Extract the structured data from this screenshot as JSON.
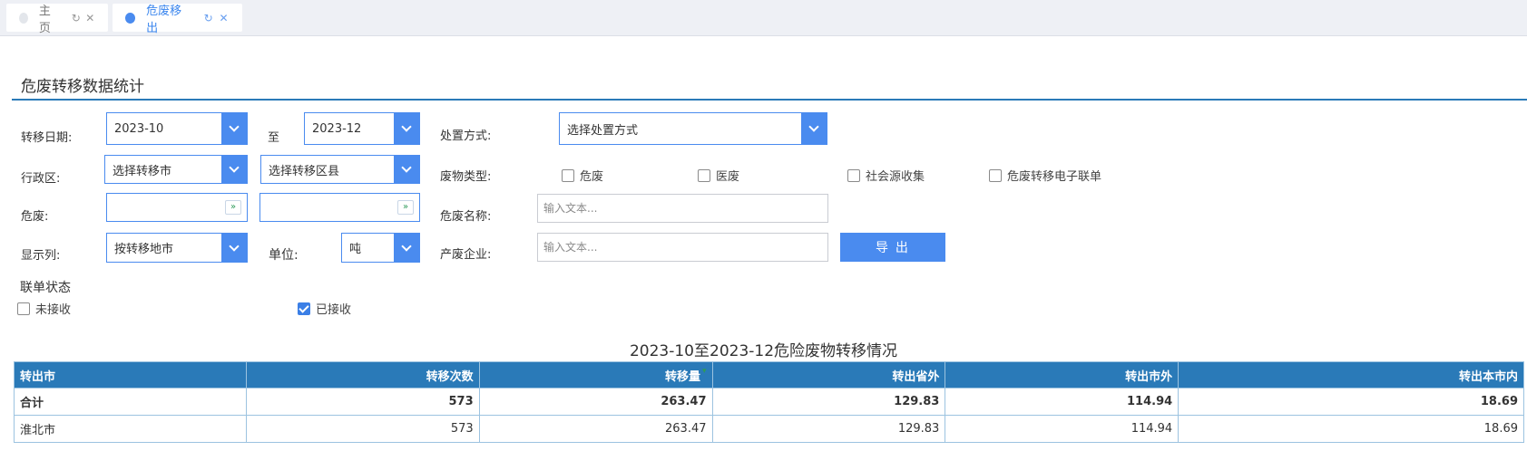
{
  "tabs": [
    {
      "label": "主页",
      "active": false
    },
    {
      "label": "危废移出",
      "active": true
    }
  ],
  "section_title": "危废转移数据统计",
  "form": {
    "date_label": "转移日期:",
    "date_from": "2023-10",
    "date_to_label": "至",
    "date_to": "2023-12",
    "disposal_label": "处置方式:",
    "disposal_value": "选择处置方式",
    "region_label": "行政区:",
    "city_value": "选择转移市",
    "county_value": "选择转移区县",
    "waste_type_label": "废物类型:",
    "waste_types": [
      {
        "label": "危废",
        "checked": false
      },
      {
        "label": "医废",
        "checked": false
      },
      {
        "label": "社会源收集",
        "checked": false
      },
      {
        "label": "危废转移电子联单",
        "checked": false
      }
    ],
    "hazard_label": "危废:",
    "hazard_name_label": "危废名称:",
    "hazard_name_placeholder": "输入文本...",
    "display_col_label": "显示列:",
    "display_col_value": "按转移地市",
    "unit_label": "单位:",
    "unit_value": "吨",
    "producer_label": "产废企业:",
    "producer_placeholder": "输入文本...",
    "export_label": "导 出",
    "status_label": "联单状态",
    "statuses": [
      {
        "label": "未接收",
        "checked": false
      },
      {
        "label": "已接收",
        "checked": true
      }
    ]
  },
  "report_title": "2023-10至2023-12危险废物转移情况",
  "table": {
    "columns": [
      "转出市",
      "转移次数",
      "转移量",
      "转出省外",
      "转出市外",
      "转出本市内"
    ],
    "rows": [
      {
        "cells": [
          "合计",
          "573",
          "263.47",
          "129.83",
          "114.94",
          "18.69"
        ],
        "total": true
      },
      {
        "cells": [
          "淮北市",
          "573",
          "263.47",
          "129.83",
          "114.94",
          "18.69"
        ],
        "total": false
      }
    ]
  },
  "colors": {
    "accent": "#4a8bef",
    "header": "#2a7ab8"
  }
}
